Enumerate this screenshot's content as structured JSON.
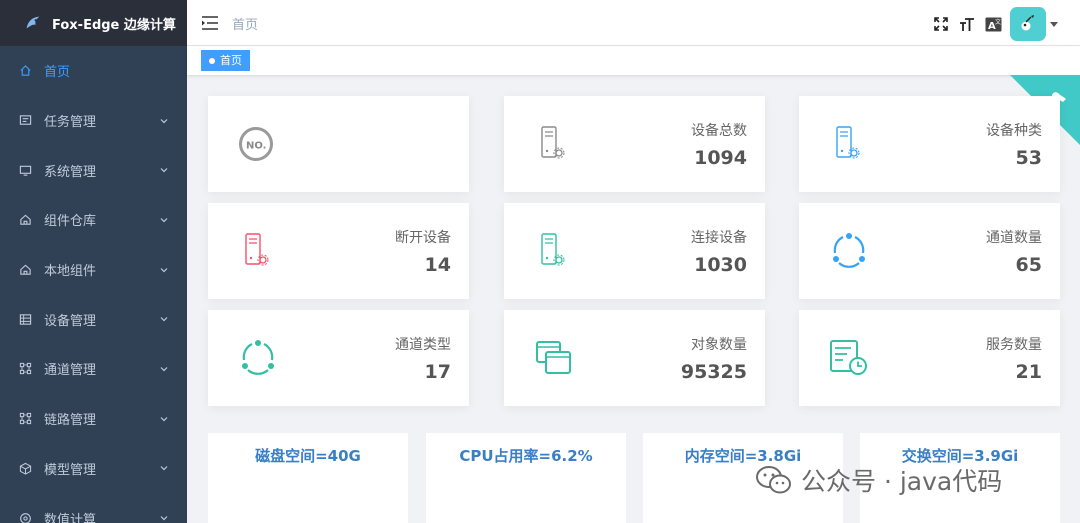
{
  "app": {
    "title": "Fox-Edge 边缘计算"
  },
  "sidebar": {
    "items": [
      {
        "label": "首页",
        "icon": "home-icon",
        "active": true,
        "has_children": false
      },
      {
        "label": "任务管理",
        "icon": "task-icon",
        "has_children": true
      },
      {
        "label": "系统管理",
        "icon": "monitor-icon",
        "has_children": true
      },
      {
        "label": "组件仓库",
        "icon": "house-icon",
        "has_children": true
      },
      {
        "label": "本地组件",
        "icon": "house-icon",
        "has_children": true
      },
      {
        "label": "设备管理",
        "icon": "grid-icon",
        "has_children": true
      },
      {
        "label": "通道管理",
        "icon": "network-icon",
        "has_children": true
      },
      {
        "label": "链路管理",
        "icon": "network-icon",
        "has_children": true
      },
      {
        "label": "模型管理",
        "icon": "cube-icon",
        "has_children": true
      },
      {
        "label": "数值计算",
        "icon": "circle-icon",
        "has_children": true
      }
    ]
  },
  "header": {
    "breadcrumb": "首页",
    "tools": [
      "fullscreen-icon",
      "font-size-icon",
      "language-icon"
    ],
    "avatar_color": "#4fcfd2"
  },
  "tags": {
    "active_label": "首页"
  },
  "cards": [
    {
      "label": "",
      "value": "",
      "icon": "no-badge-icon",
      "color": "#999999"
    },
    {
      "label": "设备总数",
      "value": "1094",
      "icon": "server-gear-icon",
      "color": "#8a8a8a"
    },
    {
      "label": "设备种类",
      "value": "53",
      "icon": "server-gear-icon",
      "color": "#36a3f7"
    },
    {
      "label": "断开设备",
      "value": "14",
      "icon": "server-gear-icon",
      "color": "#f4516c"
    },
    {
      "label": "连接设备",
      "value": "1030",
      "icon": "server-gear-icon",
      "color": "#34bfa3"
    },
    {
      "label": "通道数量",
      "value": "65",
      "icon": "cycle-icon",
      "color": "#36a3f7"
    },
    {
      "label": "通道类型",
      "value": "17",
      "icon": "cycle-icon",
      "color": "#34bfa3"
    },
    {
      "label": "对象数量",
      "value": "95325",
      "icon": "copy-icon",
      "color": "#34bfa3"
    },
    {
      "label": "服务数量",
      "value": "21",
      "icon": "calendar-clock-icon",
      "color": "#34bfa3"
    }
  ],
  "stats": [
    {
      "text": "磁盘空间=40G"
    },
    {
      "text": "CPU占用率=6.2%"
    },
    {
      "text": "内存空间=3.8Gi"
    },
    {
      "text": "交换空间=3.9Gi"
    }
  ],
  "watermark": {
    "text": "公众号 · java代码"
  },
  "colors": {
    "sidebar_bg": "#304156",
    "accent": "#409eff",
    "corner": "#40c9c6"
  }
}
